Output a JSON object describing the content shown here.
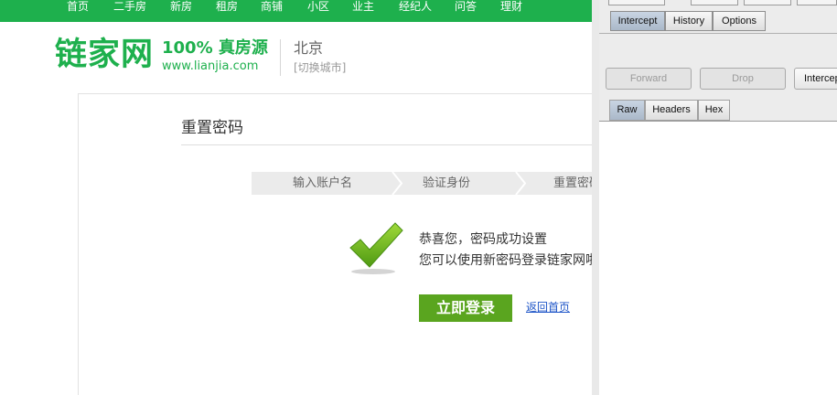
{
  "nav": {
    "items": [
      "首页",
      "二手房",
      "新房",
      "租房",
      "商铺",
      "小区",
      "业主",
      "经纪人",
      "问答",
      "理财"
    ]
  },
  "header": {
    "logo_text": "链家网",
    "slogan": "100% 真房源",
    "url": "www.lianjia.com",
    "city": "北京",
    "switch_city": "[切换城市]"
  },
  "main": {
    "title": "重置密码",
    "steps": [
      "输入账户名",
      "验证身份",
      "重置密码"
    ],
    "message_line1": "恭喜您，密码成功设置",
    "message_line2": "您可以使用新密码登录链家网啦",
    "login_button": "立即登录",
    "home_link": "返回首页",
    "icon": "checkmark-icon"
  },
  "burp": {
    "tabs": [
      "Intercept",
      "History",
      "Options"
    ],
    "active_tab": "Intercept",
    "buttons": {
      "forward": "Forward",
      "drop": "Drop",
      "intercept": "Intercept is on"
    },
    "subtabs": [
      "Raw",
      "Headers",
      "Hex"
    ],
    "active_subtab": "Raw"
  },
  "colors": {
    "brand_green": "#1eb04d",
    "button_green": "#5aa51f",
    "link_blue": "#1f56c8"
  }
}
